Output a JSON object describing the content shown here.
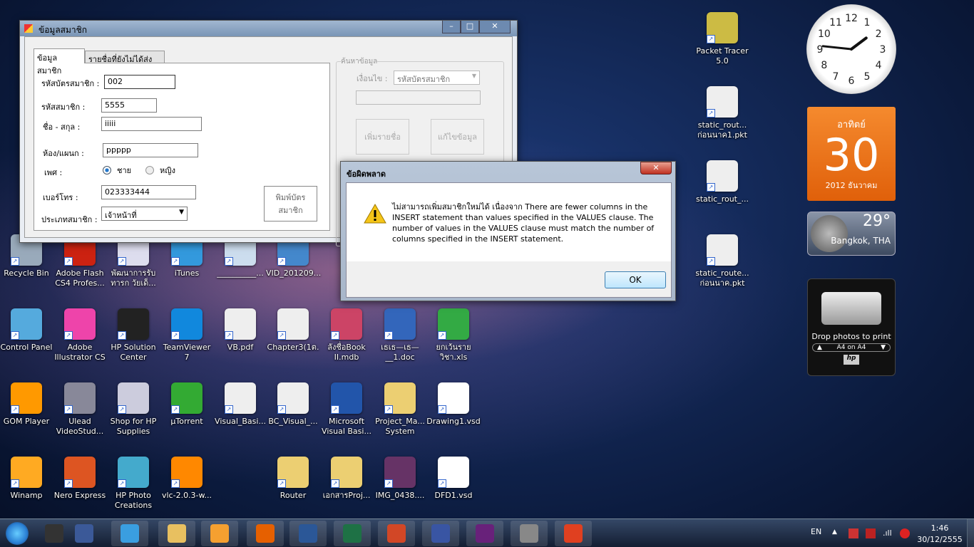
{
  "form_window": {
    "title": "ข้อมูลสมาชิก",
    "tabs": [
      {
        "label": "ข้อมูลสมาชิก",
        "active": true
      },
      {
        "label": "รายชื่อที่ยังไม่ได้ส่งคืน",
        "active": false
      }
    ],
    "fields": {
      "card_id_label": "รหัสบัตรสมาชิก :",
      "card_id": "002",
      "member_id_label": "รหัสสมาชิก :",
      "member_id": "5555",
      "name_label": "ชื่อ - สกุล :",
      "name": "iiiii",
      "dept_label": "ห้อง/แผนก :",
      "dept": "ppppp",
      "gender_label": "เพศ :",
      "gender_male": "ชาย",
      "gender_female": "หญิง",
      "gender_selected": "male",
      "phone_label": "เบอร์โทร :",
      "phone": "023333444",
      "type_label": "ประเภทสมาชิก :",
      "type": "เจ้าหน้าที่"
    },
    "print_card_button": "พิมพ์บัตร\nสมาชิก",
    "search": {
      "group_label": "ค้นหาข้อมูล",
      "condition_label": "เงื่อนไข :",
      "condition": "รหัสบัตรสมาชิก",
      "query": "",
      "add_button": "เพิ่มรายชื่อ",
      "edit_button": "แก้ไขข้อมูล"
    }
  },
  "error_dialog": {
    "title": "ข้อผิดพลาด",
    "icon": "warning-icon",
    "message": "ไม่สามารถเพิ่มสมาชิกใหม่ได้ เนื่องจาก There are fewer columns in the INSERT statement than values specified in the VALUES clause. The number of values in the VALUES clause must match the number of columns specified in the INSERT statement.",
    "ok_button": "OK"
  },
  "desktop_icons": [
    {
      "label": "Recycle Bin",
      "color": "#9ab"
    },
    {
      "label": "Adobe Flash CS4 Profes...",
      "color": "#c21"
    },
    {
      "label": "พัฒนาการรับ ทารก วัยเด็...",
      "color": "#dde"
    },
    {
      "label": "iTunes",
      "color": "#39d"
    },
    {
      "label": "__________...",
      "color": "#cde"
    },
    {
      "label": "VID_201209...",
      "color": "#48c"
    },
    {
      "label": "Control Panel",
      "color": "#5ad"
    },
    {
      "label": "Adobe Illustrator CS",
      "color": "#e4a"
    },
    {
      "label": "HP Solution Center",
      "color": "#222"
    },
    {
      "label": "TeamViewer 7",
      "color": "#18d"
    },
    {
      "label": "VB.pdf",
      "color": "#eee"
    },
    {
      "label": "Chapter3(1ต.",
      "color": "#eee"
    },
    {
      "label": "ลังชื่อBook II.mdb",
      "color": "#c46"
    },
    {
      "label": "เธเธ—เธ— __1.doc",
      "color": "#36b"
    },
    {
      "label": "ยกเว้นราย วิชา.xls",
      "color": "#3a4"
    },
    {
      "label": "GOM Player",
      "color": "#f90"
    },
    {
      "label": "Ulead VideoStud...",
      "color": "#889"
    },
    {
      "label": "Shop for HP Supplies",
      "color": "#ccd"
    },
    {
      "label": "µTorrent",
      "color": "#3a3"
    },
    {
      "label": "Visual_Basi...",
      "color": "#eee"
    },
    {
      "label": "BC_Visual_...",
      "color": "#eee"
    },
    {
      "label": "Microsoft Visual Basi...",
      "color": "#25a"
    },
    {
      "label": "Project_Ma... System",
      "color": "#eccf72"
    },
    {
      "label": "Drawing1.vsd",
      "color": "#fff"
    },
    {
      "label": "Winamp",
      "color": "#fa2"
    },
    {
      "label": "Nero Express",
      "color": "#d52"
    },
    {
      "label": "HP Photo Creations",
      "color": "#4ac"
    },
    {
      "label": "vlc-2.0.3-w...",
      "color": "#f80"
    },
    {
      "label": "Router",
      "color": "#eccf72"
    },
    {
      "label": "เอกสารProj...",
      "color": "#eccf72"
    },
    {
      "label": "IMG_0438....",
      "color": "#636"
    },
    {
      "label": "DFD1.vsd",
      "color": "#fff"
    },
    {
      "label": "Packet Tracer 5.0",
      "color": "#cb4"
    },
    {
      "label": "static_rout... ก่อนนาค1.pkt",
      "color": "#eee"
    },
    {
      "label": "static_rout_...",
      "color": "#eee"
    },
    {
      "label": "static_route... ก่อนนาค.pkt",
      "color": "#eee"
    }
  ],
  "gadgets": {
    "clock": {
      "hours": 1,
      "minutes": 46,
      "numerals": [
        "12",
        "1",
        "2",
        "3",
        "4",
        "5",
        "6",
        "7",
        "8",
        "9",
        "10",
        "11"
      ]
    },
    "calendar": {
      "weekday": "อาทิตย์",
      "day": "30",
      "month_year": "2012 ธันวาคม"
    },
    "weather": {
      "temp": "29°",
      "location": "Bangkok, THA"
    },
    "printer": {
      "caption": "Drop photos to print",
      "paper": "A4 on A4",
      "brand": "hp"
    }
  },
  "taskbar": {
    "items": [
      {
        "name": "start",
        "color": "#2a7fd4"
      },
      {
        "name": "steam",
        "color": "#333"
      },
      {
        "name": "facebook",
        "color": "#3b5998"
      },
      {
        "name": "internet-explorer",
        "color": "#3a9ee0"
      },
      {
        "name": "file-explorer",
        "color": "#e8c060"
      },
      {
        "name": "media-player",
        "color": "#f5a030"
      },
      {
        "name": "firefox",
        "color": "#e66000"
      },
      {
        "name": "word",
        "color": "#2b5797"
      },
      {
        "name": "excel",
        "color": "#1e7145"
      },
      {
        "name": "powerpoint",
        "color": "#d24726"
      },
      {
        "name": "visio",
        "color": "#3955a3"
      },
      {
        "name": "visual-basic",
        "color": "#68217a"
      },
      {
        "name": "tools",
        "color": "#888"
      },
      {
        "name": "vb-app",
        "color": "#e04020"
      }
    ],
    "language": "EN",
    "time": "1:46",
    "date": "30/12/2555"
  }
}
